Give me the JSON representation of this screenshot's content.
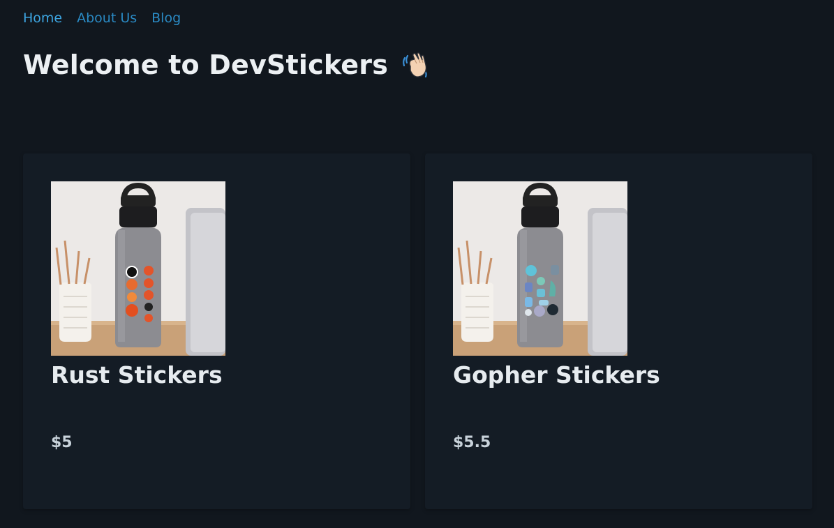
{
  "nav": {
    "items": [
      {
        "label": "Home",
        "active": true
      },
      {
        "label": "About Us",
        "active": false
      },
      {
        "label": "Blog",
        "active": false
      }
    ]
  },
  "header": {
    "title": "Welcome to DevStickers",
    "emoji_icon": "waving-hand-icon"
  },
  "products": [
    {
      "name": "Rust Stickers",
      "price": "$5",
      "image_icon": "water-bottle-rust-stickers"
    },
    {
      "name": "Gopher Stickers",
      "price": "$5.5",
      "image_icon": "water-bottle-gopher-stickers"
    }
  ],
  "colors": {
    "background": "#11171e",
    "card": "#141c25",
    "link": "#2a8ac4",
    "text": "#ecf0f3"
  }
}
